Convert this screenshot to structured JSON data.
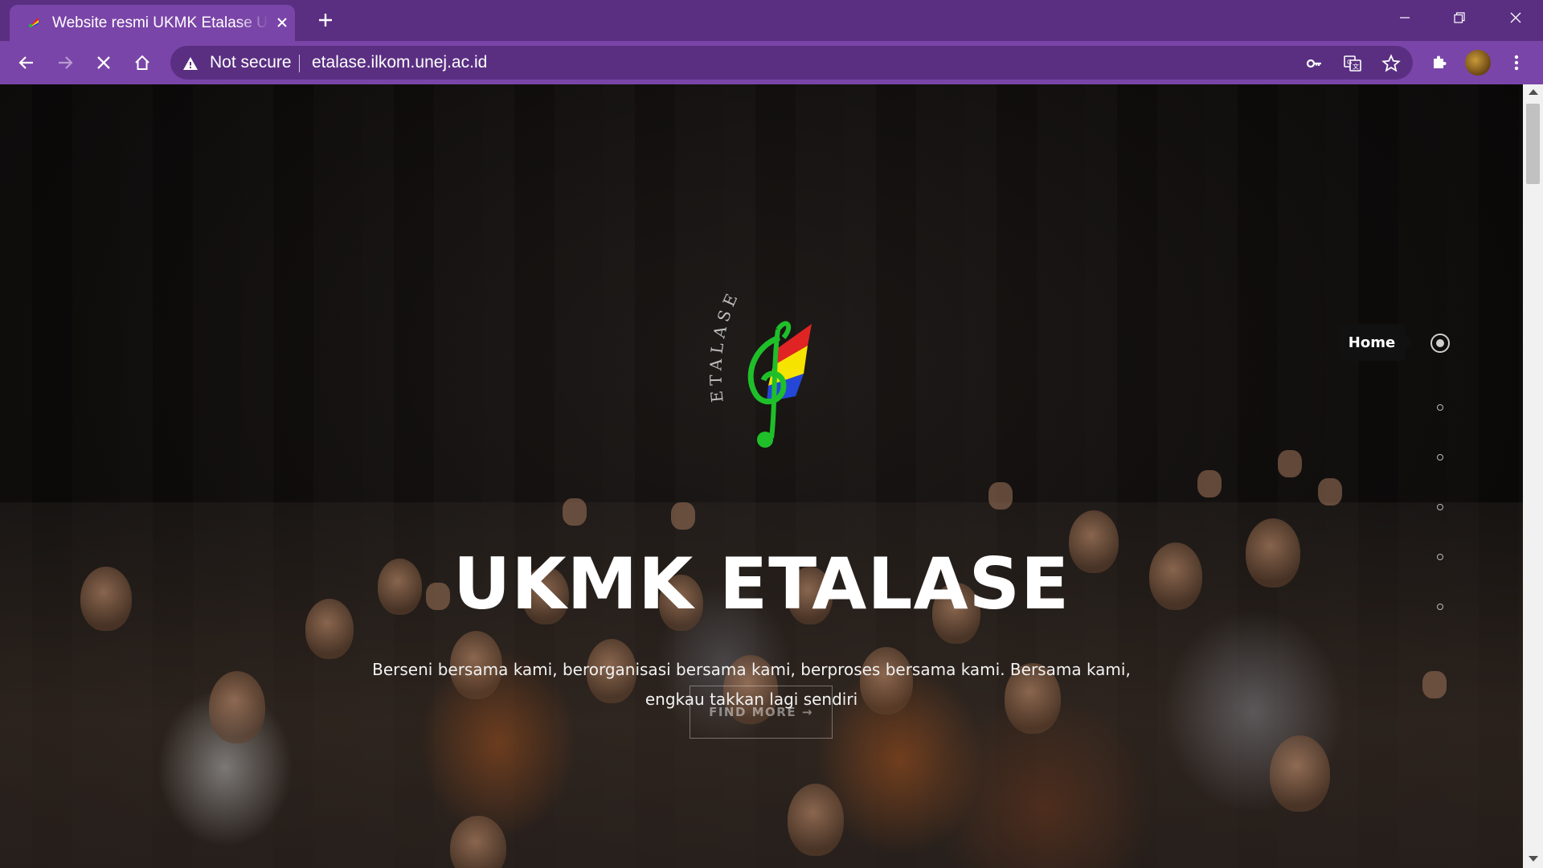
{
  "browser": {
    "tab": {
      "title": "Website resmi UKMK Etalase UNEJ",
      "favicon": "etalase-favicon-icon",
      "close_icon": "close-icon"
    },
    "new_tab_icon": "plus-icon",
    "window_controls": [
      "minimize-icon",
      "restore-icon",
      "close-icon"
    ],
    "nav": [
      "back-arrow-icon",
      "forward-arrow-icon",
      "stop-loading-icon",
      "home-icon"
    ],
    "omnibox": {
      "security_label": "Not secure",
      "url": "etalase.ilkom.unej.ac.id",
      "right_icons": [
        "key-icon",
        "translate-icon",
        "star-icon"
      ]
    },
    "extensions_icon": "puzzle-icon",
    "menu_icon": "kebab-menu-icon",
    "colors": {
      "tabstrip": "#5a2f82",
      "toolbar": "#7a45a8",
      "omnibox": "#5a2f82"
    }
  },
  "page": {
    "logo": {
      "arc_text": "ETALASE",
      "colors": [
        "#e02424",
        "#f6e400",
        "#2447d8",
        "#1fbf2a"
      ]
    },
    "hero": {
      "title": "UKMK ETALASE",
      "text": "Berseni bersama kami, berorganisasi bersama kami, berproses bersama kami. Bersama kami, engkau takkan lagi sendiri",
      "button_label": "FIND MORE →"
    },
    "dot_nav": {
      "active_label": "Home",
      "dot_count": 6
    }
  }
}
